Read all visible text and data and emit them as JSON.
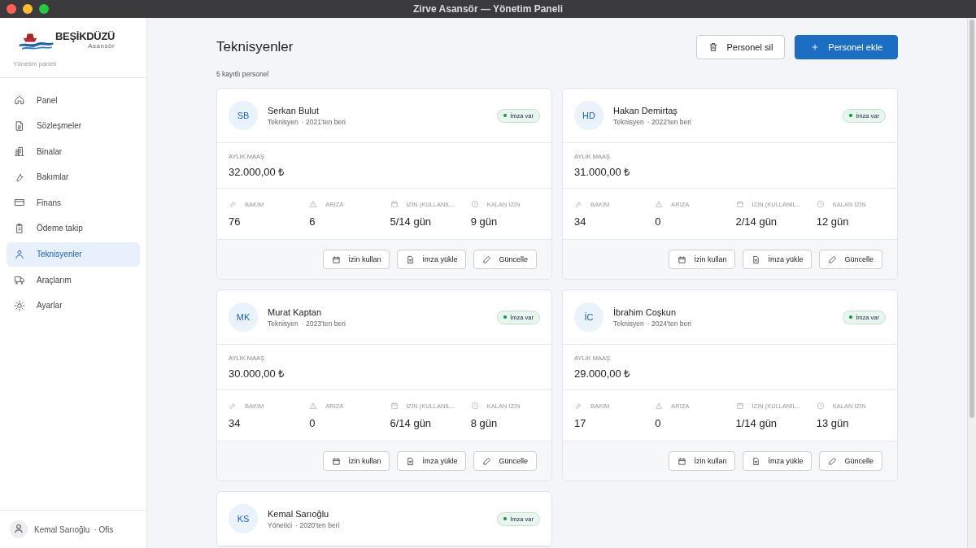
{
  "window": {
    "title": "Zirve Asansör — Yönetim Paneli"
  },
  "sidebar": {
    "logo": {
      "name": "BEŞİKDÜZÜ",
      "tagline": "Asansör"
    },
    "subtitle": "Yönetim paneli",
    "items": [
      {
        "label": "Panel",
        "selected": false
      },
      {
        "label": "Sözleşmeler",
        "selected": false
      },
      {
        "label": "Binalar",
        "selected": false
      },
      {
        "label": "Bakımlar",
        "selected": false
      },
      {
        "label": "Finans",
        "selected": false
      },
      {
        "label": "Ödeme takip",
        "selected": false
      },
      {
        "label": "Teknisyenler",
        "selected": true
      },
      {
        "label": "Araçlarım",
        "selected": false
      },
      {
        "label": "Ayarlar",
        "selected": false
      }
    ],
    "user": {
      "name": "Kemal Sarıoğlu",
      "role": "· Ofis"
    }
  },
  "page": {
    "title": "Teknisyenler",
    "count": "5 kayıtlı personel",
    "buttons": [
      {
        "label": "Personel sil",
        "kind": "delete"
      },
      {
        "label": "Personel ekle",
        "kind": "add"
      }
    ]
  },
  "cards": [
    {
      "initials": "SB",
      "name": "Serkan Bulut",
      "role": "Teknisyen",
      "since": "· 2021'ten beri",
      "badge": "İmza var",
      "salary_label": "AYLIK MAAŞ",
      "salary": "32.000,00 ₺",
      "stats": [
        {
          "label": "BAKIM",
          "value": "76"
        },
        {
          "label": "ARIZA",
          "value": "6"
        },
        {
          "label": "İZİN (KULLANIL...",
          "value": "5/14 gün"
        },
        {
          "label": "KALAN İZİN",
          "value": "9 gün"
        }
      ],
      "actions": [
        "İzin kullan",
        "İmza yükle",
        "Güncelle"
      ]
    },
    {
      "initials": "HD",
      "name": "Hakan Demirtaş",
      "role": "Teknisyen",
      "since": "· 2022'ten beri",
      "badge": "İmza var",
      "salary_label": "AYLIK MAAŞ",
      "salary": "31.000,00 ₺",
      "stats": [
        {
          "label": "BAKIM",
          "value": "34"
        },
        {
          "label": "ARIZA",
          "value": "0"
        },
        {
          "label": "İZİN (KULLANIL...",
          "value": "2/14 gün"
        },
        {
          "label": "KALAN İZİN",
          "value": "12 gün"
        }
      ],
      "actions": [
        "İzin kullan",
        "İmza yükle",
        "Güncelle"
      ]
    },
    {
      "initials": "MK",
      "name": "Murat Kaptan",
      "role": "Teknisyen",
      "since": "· 2023'ten beri",
      "badge": "İmza var",
      "salary_label": "AYLIK MAAŞ",
      "salary": "30.000,00 ₺",
      "stats": [
        {
          "label": "BAKIM",
          "value": "34"
        },
        {
          "label": "ARIZA",
          "value": "0"
        },
        {
          "label": "İZİN (KULLANIL...",
          "value": "6/14 gün"
        },
        {
          "label": "KALAN İZİN",
          "value": "8 gün"
        }
      ],
      "actions": [
        "İzin kullan",
        "İmza yükle",
        "Güncelle"
      ]
    },
    {
      "initials": "İC",
      "name": "İbrahim Coşkun",
      "role": "Teknisyen",
      "since": "· 2024'ten beri",
      "badge": "İmza var",
      "salary_label": "AYLIK MAAŞ",
      "salary": "29.000,00 ₺",
      "stats": [
        {
          "label": "BAKIM",
          "value": "17"
        },
        {
          "label": "ARIZA",
          "value": "0"
        },
        {
          "label": "İZİN (KULLANIL...",
          "value": "1/14 gün"
        },
        {
          "label": "KALAN İZİN",
          "value": "13 gün"
        }
      ],
      "actions": [
        "İzin kullan",
        "İmza yükle",
        "Güncelle"
      ]
    },
    {
      "initials": "KS",
      "name": "Kemal Sarıoğlu",
      "role": "Yönetici",
      "since": "· 2020'ten beri",
      "badge": "İmza var"
    }
  ]
}
